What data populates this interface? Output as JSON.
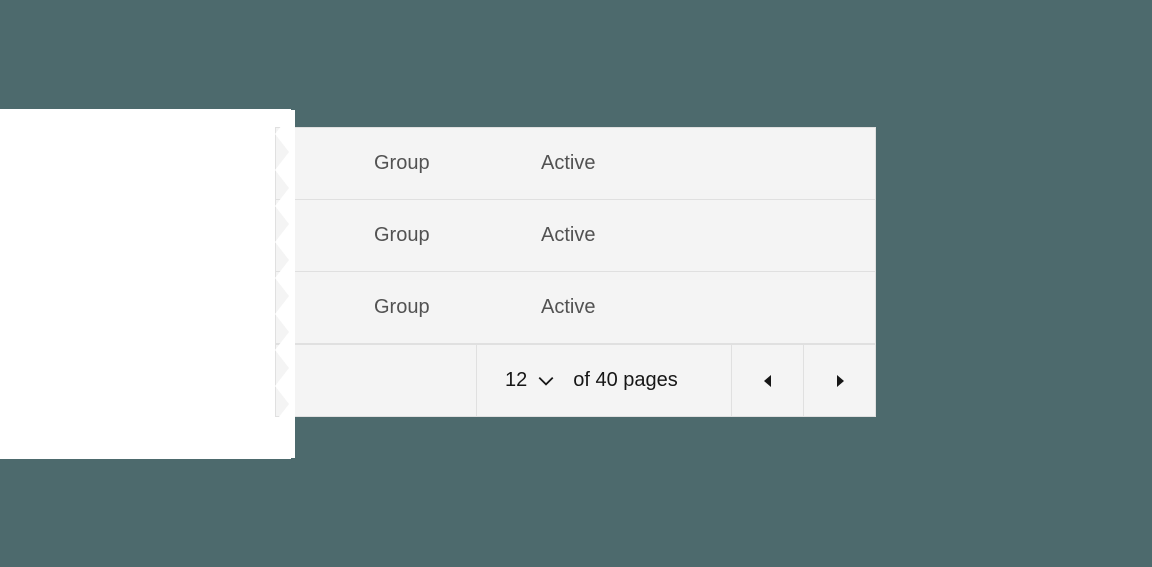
{
  "table": {
    "rows": [
      {
        "group": "Group",
        "status": "Active"
      },
      {
        "group": "Group",
        "status": "Active"
      },
      {
        "group": "Group",
        "status": "Active"
      }
    ]
  },
  "pagination": {
    "current_page": "12",
    "of_text": "of 40 pages"
  }
}
